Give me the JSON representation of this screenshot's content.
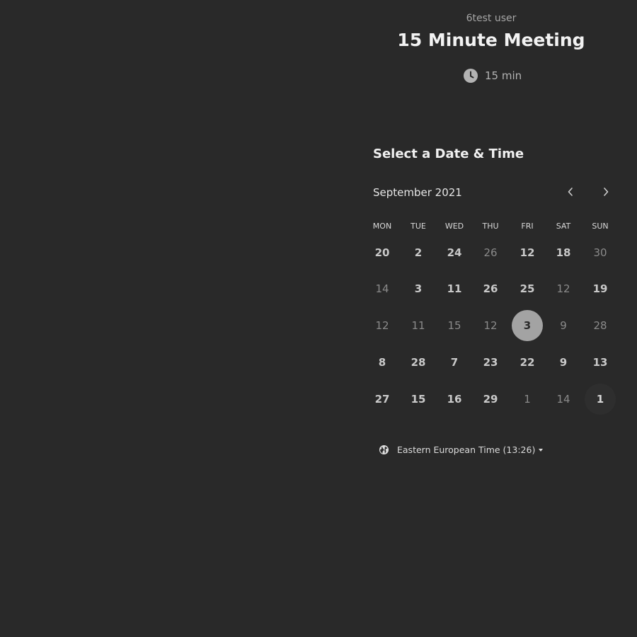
{
  "header": {
    "host": "6test user",
    "title": "15 Minute Meeting",
    "duration": "15 min",
    "duration_icon": "clock-icon"
  },
  "picker": {
    "title": "Select a Date & Time",
    "month": "September 2021",
    "prev_icon": "chevron-left-icon",
    "next_icon": "chevron-right-icon",
    "weekdays": [
      "MON",
      "TUE",
      "WED",
      "THU",
      "FRI",
      "SAT",
      "SUN"
    ],
    "weeks": [
      [
        {
          "label": "20",
          "available": true
        },
        {
          "label": "2",
          "available": true
        },
        {
          "label": "24",
          "available": true
        },
        {
          "label": "26",
          "available": false
        },
        {
          "label": "12",
          "available": true
        },
        {
          "label": "18",
          "available": true
        },
        {
          "label": "30",
          "available": false
        }
      ],
      [
        {
          "label": "14",
          "available": false
        },
        {
          "label": "3",
          "available": true
        },
        {
          "label": "11",
          "available": true
        },
        {
          "label": "26",
          "available": true
        },
        {
          "label": "25",
          "available": true
        },
        {
          "label": "12",
          "available": false
        },
        {
          "label": "19",
          "available": true
        }
      ],
      [
        {
          "label": "12",
          "available": false
        },
        {
          "label": "11",
          "available": false
        },
        {
          "label": "15",
          "available": false
        },
        {
          "label": "12",
          "available": false
        },
        {
          "label": "3",
          "available": true,
          "selected": true
        },
        {
          "label": "9",
          "available": false
        },
        {
          "label": "28",
          "available": false
        }
      ],
      [
        {
          "label": "8",
          "available": true
        },
        {
          "label": "28",
          "available": true
        },
        {
          "label": "7",
          "available": true
        },
        {
          "label": "23",
          "available": true
        },
        {
          "label": "22",
          "available": true
        },
        {
          "label": "9",
          "available": true
        },
        {
          "label": "13",
          "available": true
        }
      ],
      [
        {
          "label": "27",
          "available": true
        },
        {
          "label": "15",
          "available": true
        },
        {
          "label": "16",
          "available": true
        },
        {
          "label": "29",
          "available": true
        },
        {
          "label": "1",
          "available": false
        },
        {
          "label": "14",
          "available": false
        },
        {
          "label": "1",
          "available": true,
          "today": true
        }
      ]
    ]
  },
  "timezone": {
    "label": "Eastern European Time (13:26)",
    "icon": "globe-icon"
  },
  "colors": {
    "background": "#292929",
    "selected_day": "#a3a3a3",
    "text_primary": "#f2f2f2",
    "text_muted": "#9a9a9a"
  }
}
